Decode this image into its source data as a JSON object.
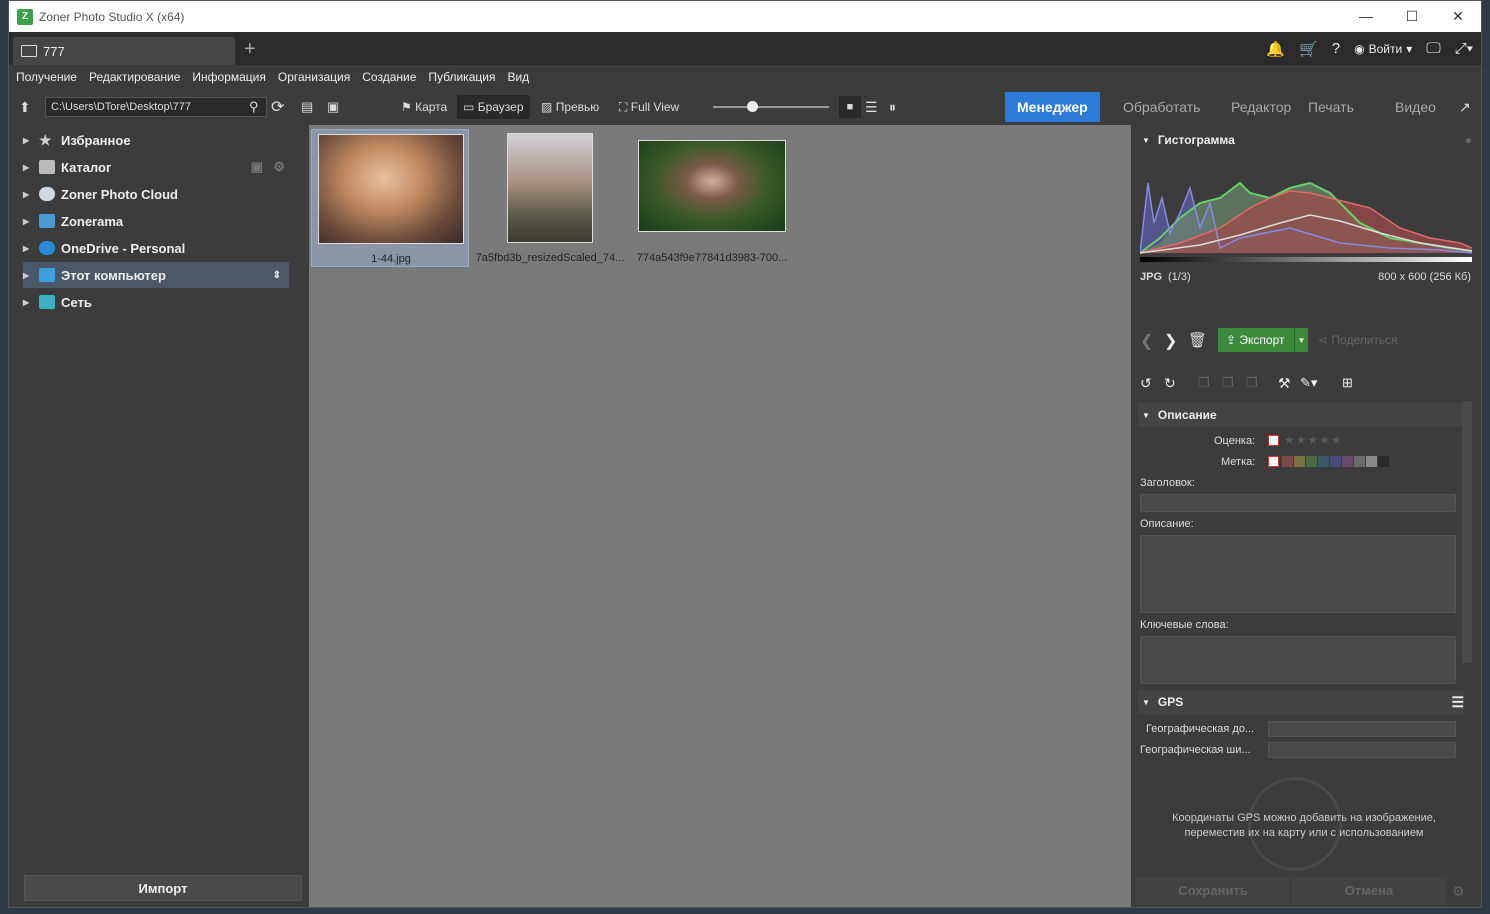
{
  "window": {
    "title": "Zoner Photo Studio X (x64)",
    "minimize": "—",
    "maximize": "☐",
    "close": "✕"
  },
  "tab": {
    "label": "777",
    "add": "+"
  },
  "topbar": {
    "login": "Войти"
  },
  "menu": [
    "Получение",
    "Редактирование",
    "Информация",
    "Организация",
    "Создание",
    "Публикация",
    "Вид"
  ],
  "toolbar": {
    "path": "C:\\Users\\DTore\\Desktop\\777",
    "map": "Карта",
    "browser": "Браузер",
    "preview": "Превью",
    "fullview": "Full View"
  },
  "modules": {
    "manager": "Менеджер",
    "develop": "Обработать",
    "editor": "Редактор",
    "print": "Печать",
    "video": "Видео"
  },
  "navigator": [
    {
      "label": "Избранное"
    },
    {
      "label": "Каталог"
    },
    {
      "label": "Zoner Photo Cloud"
    },
    {
      "label": "Zonerama"
    },
    {
      "label": "OneDrive - Personal"
    },
    {
      "label": "Этот компьютер"
    },
    {
      "label": "Сеть"
    }
  ],
  "import_label": "Импорт",
  "thumbnails": [
    {
      "caption": "1-44.jpg"
    },
    {
      "caption": "7a5fbd3b_resizedScaled_74..."
    },
    {
      "caption": "774a543f9e77841d3983-700..."
    }
  ],
  "histogram": {
    "title": "Гистограмма",
    "format": "JPG",
    "index": "(1/3)",
    "size": "800 x 600 (256 Кб)"
  },
  "actions": {
    "export": "Экспорт",
    "share": "Поделиться"
  },
  "description": {
    "title": "Описание",
    "rating_label": "Оценка:",
    "label_label": "Метка:",
    "heading_label": "Заголовок:",
    "desc_label": "Описание:",
    "keywords_label": "Ключевые слова:",
    "label_colors": [
      "#7a4a4a",
      "#7a7040",
      "#4a6a40",
      "#3a5a6a",
      "#4a4a7a",
      "#6a4a6a",
      "#6a6a6a",
      "#8a8a8a",
      "#2a2a2a"
    ]
  },
  "gps": {
    "title": "GPS",
    "longitude_label": "Географическая до...",
    "latitude_label": "Географическая ши...",
    "info_line1": "Координаты GPS можно добавить на изображение,",
    "info_line2": "переместив их на карту или с использованием"
  },
  "footer": {
    "save": "Сохранить",
    "cancel": "Отмена"
  }
}
